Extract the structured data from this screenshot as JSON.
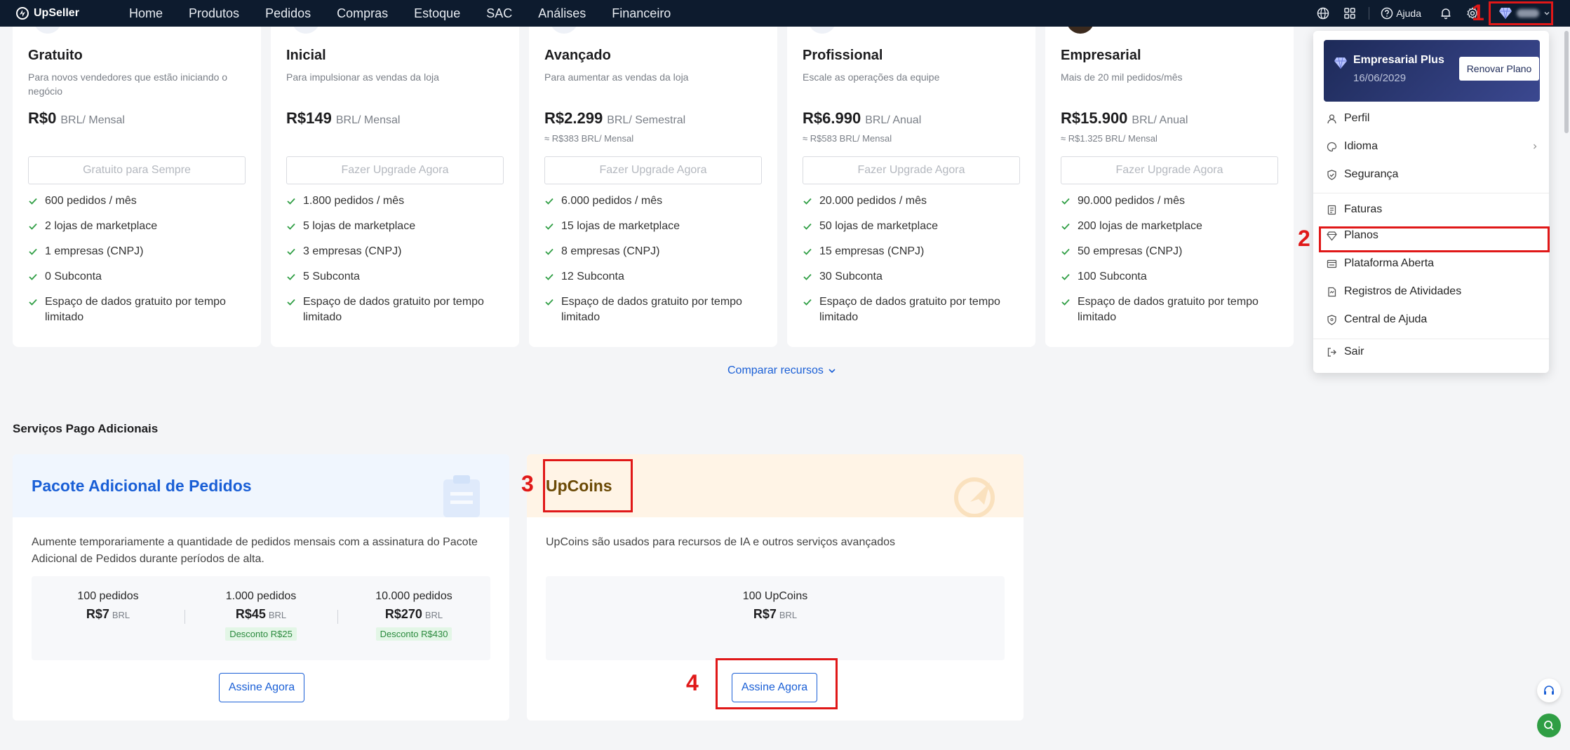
{
  "app": {
    "name": "UpSeller"
  },
  "nav": {
    "items": [
      "Home",
      "Produtos",
      "Pedidos",
      "Compras",
      "Estoque",
      "SAC",
      "Análises",
      "Financeiro"
    ],
    "help_label": "Ajuda"
  },
  "plans": [
    {
      "name": "Gratuito",
      "description": "Para novos vendedores que estão iniciando o negócio",
      "price": "R$0",
      "period": "BRL/ Mensal",
      "approx": "",
      "button": "Gratuito para Sempre",
      "features": [
        "600 pedidos / mês",
        "2 lojas de marketplace",
        "1 empresas (CNPJ)",
        "0 Subconta",
        "Espaço de dados gratuito por tempo limitado"
      ]
    },
    {
      "name": "Inicial",
      "description": "Para impulsionar as vendas da loja",
      "price": "R$149",
      "period": "BRL/ Mensal",
      "approx": "",
      "button": "Fazer Upgrade Agora",
      "features": [
        "1.800 pedidos / mês",
        "5 lojas de marketplace",
        "3 empresas (CNPJ)",
        "5 Subconta",
        "Espaço de dados gratuito por tempo limitado"
      ]
    },
    {
      "name": "Avançado",
      "description": "Para aumentar as vendas da loja",
      "price": "R$2.299",
      "period": "BRL/ Semestral",
      "approx": "≈ R$383 BRL/ Mensal",
      "button": "Fazer Upgrade Agora",
      "features": [
        "6.000 pedidos / mês",
        "15 lojas de marketplace",
        "8 empresas (CNPJ)",
        "12 Subconta",
        "Espaço de dados gratuito por tempo limitado"
      ]
    },
    {
      "name": "Profissional",
      "description": "Escale as operações da equipe",
      "price": "R$6.990",
      "period": "BRL/ Anual",
      "approx": "≈ R$583 BRL/ Mensal",
      "button": "Fazer Upgrade Agora",
      "features": [
        "20.000 pedidos / mês",
        "50 lojas de marketplace",
        "15 empresas (CNPJ)",
        "30 Subconta",
        "Espaço de dados gratuito por tempo limitado"
      ]
    },
    {
      "name": "Empresarial",
      "description": "Mais de 20 mil pedidos/mês",
      "price": "R$15.900",
      "period": "BRL/ Anual",
      "approx": "≈ R$1.325 BRL/ Mensal",
      "button": "Fazer Upgrade Agora",
      "features": [
        "90.000 pedidos / mês",
        "200 lojas de marketplace",
        "50 empresas (CNPJ)",
        "100 Subconta",
        "Espaço de dados gratuito por tempo limitado"
      ]
    }
  ],
  "compare_label": "Comparar recursos",
  "services": {
    "section_title": "Serviços Pago Adicionais",
    "orders_pack": {
      "title": "Pacote Adicional de Pedidos",
      "description": "Aumente temporariamente a quantidade de pedidos mensais com a assinatura do Pacote Adicional de Pedidos durante períodos de alta.",
      "packages": [
        {
          "name": "100 pedidos",
          "price": "R$7",
          "currency": "BRL",
          "discount": ""
        },
        {
          "name": "1.000 pedidos",
          "price": "R$45",
          "currency": "BRL",
          "discount": "Desconto R$25"
        },
        {
          "name": "10.000 pedidos",
          "price": "R$270",
          "currency": "BRL",
          "discount": "Desconto R$430"
        }
      ],
      "cta": "Assine Agora"
    },
    "upcoins": {
      "title": "UpCoins",
      "description": "UpCoins são usados para recursos de IA e outros serviços avançados",
      "package": {
        "name": "100 UpCoins",
        "price": "R$7",
        "currency": "BRL"
      },
      "cta": "Assine Agora"
    }
  },
  "user_menu": {
    "plan_name": "Empresarial Plus",
    "plan_expiry": "16/06/2029",
    "renew_label": "Renovar Plano",
    "items": [
      "Perfil",
      "Idioma",
      "Segurança",
      "Faturas",
      "Planos",
      "Plataforma Aberta",
      "Registros de Atividades",
      "Central de Ajuda",
      "Sair"
    ]
  },
  "annotations": [
    "1",
    "2",
    "3",
    "4"
  ],
  "colors": {
    "nav_bg": "#0d1b2e",
    "accent": "#1a5fd6",
    "annotation": "#e01818",
    "check": "#2f9e44"
  }
}
